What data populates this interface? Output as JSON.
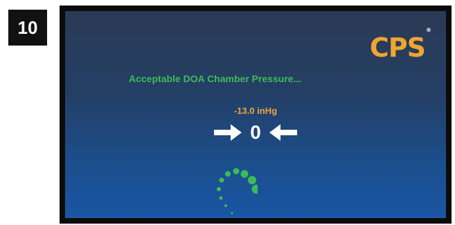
{
  "step": {
    "number": "10"
  },
  "brand": {
    "name": "CPS",
    "registered_mark": "®"
  },
  "screen": {
    "status_message": "Acceptable DOA Chamber Pressure...",
    "target_pressure": "-13.0 inHg",
    "current_reading": "0"
  },
  "icons": {
    "left_arrow": "arrow-right-icon",
    "right_arrow": "arrow-left-icon",
    "spinner": "loading-spinner-icon"
  },
  "colors": {
    "status_green": "#3dbb5a",
    "pressure_orange": "#e9a640",
    "brand_orange": "#f0a530",
    "screen_top": "#2b3a55",
    "screen_bottom": "#1a56a4"
  }
}
